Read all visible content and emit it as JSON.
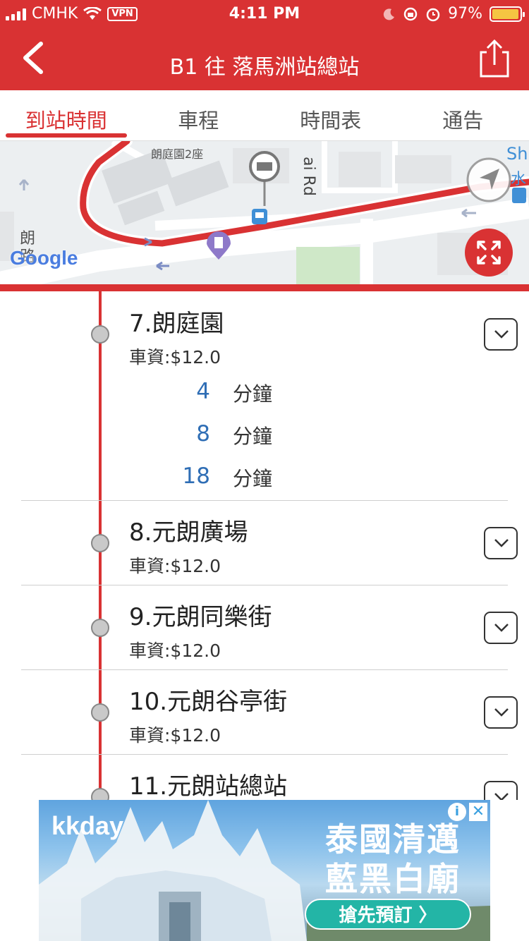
{
  "status_bar": {
    "carrier": "CMHK",
    "vpn": "VPN",
    "time": "4:11 PM",
    "battery": "97%",
    "battery_level": 0.97
  },
  "nav": {
    "title": "B1 往 落馬洲站總站"
  },
  "tabs": [
    {
      "label": "到站時間",
      "active": true
    },
    {
      "label": "車程",
      "active": false
    },
    {
      "label": "時間表",
      "active": false
    },
    {
      "label": "通告",
      "active": false
    }
  ],
  "map": {
    "label_building": "朗庭園2座",
    "label_road": "ai Rd",
    "label_sh": "Sh",
    "label_water": "水",
    "label_road_vertical": "朗路",
    "google": "Google"
  },
  "stops": [
    {
      "name": "7.朗庭園",
      "fare": "車資:$12.0",
      "etas": [
        {
          "minutes": "4",
          "unit": "分鐘"
        },
        {
          "minutes": "8",
          "unit": "分鐘"
        },
        {
          "minutes": "18",
          "unit": "分鐘"
        }
      ]
    },
    {
      "name": "8.元朗廣場",
      "fare": "車資:$12.0"
    },
    {
      "name": "9.元朗同樂街",
      "fare": "車資:$12.0"
    },
    {
      "name": "10.元朗谷亭街",
      "fare": "車資:$12.0"
    },
    {
      "name": "11.元朗站總站",
      "fare": ""
    }
  ],
  "ad": {
    "brand": "kkday",
    "headline_1": "泰國清邁",
    "headline_2": "藍黑白廟",
    "cta": "搶先預訂 〉",
    "info": "i",
    "close": "✕"
  },
  "colors": {
    "primary": "#d93233",
    "eta": "#2f6eb5",
    "cta": "#23b5a6"
  }
}
